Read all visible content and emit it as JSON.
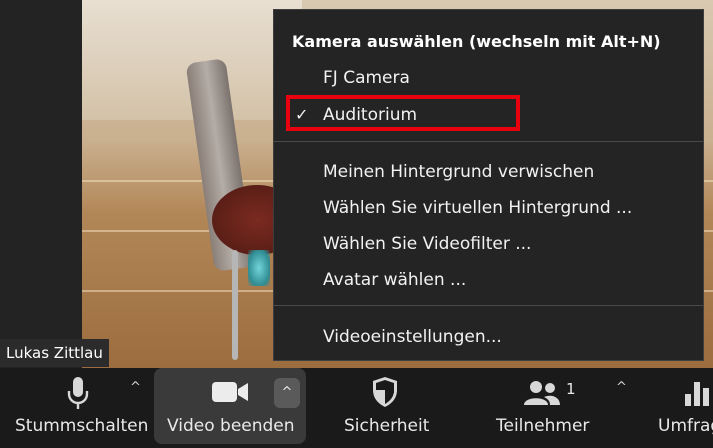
{
  "participant_name": "Lukas Zittlau",
  "camera_menu": {
    "heading": "Kamera auswählen (wechseln mit Alt+N)",
    "cameras": [
      {
        "label": "FJ Camera",
        "checked": false
      },
      {
        "label": "Auditorium",
        "checked": true
      }
    ],
    "check_glyph": "✓",
    "background_options": [
      {
        "label": "Meinen Hintergrund verwischen"
      },
      {
        "label": "Wählen Sie virtuellen Hintergrund ..."
      },
      {
        "label": "Wählen Sie Videofilter ..."
      },
      {
        "label": "Avatar wählen ..."
      }
    ],
    "settings_label": "Videoeinstellungen...",
    "highlight_color": "#e8000f"
  },
  "toolbar": {
    "mute_label": "Stummschalten",
    "video_label": "Video beenden",
    "security_label": "Sicherheit",
    "participants_label": "Teilnehmer",
    "participants_count": "1",
    "poll_label": "Umfrag",
    "caret_glyph": "^"
  }
}
